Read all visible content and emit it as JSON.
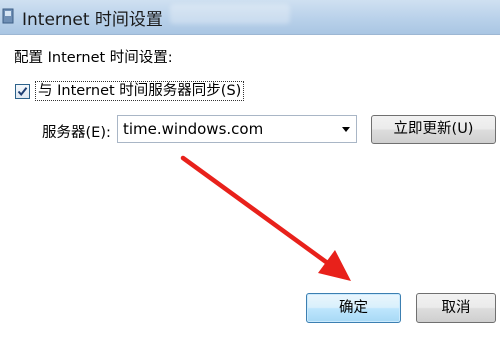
{
  "window": {
    "title": "Internet 时间设置"
  },
  "dialog": {
    "config_label": "配置 Internet 时间设置:",
    "sync_checkbox": {
      "label": "与 Internet 时间服务器同步(S)",
      "checked": true
    },
    "server": {
      "label": "服务器(E):",
      "value": "time.windows.com"
    },
    "update_button": "立即更新(U)",
    "ok_button": "确定",
    "cancel_button": "取消"
  },
  "annotation": {
    "color": "#e8211b"
  },
  "colors": {
    "titlebar": "#b9d1ea",
    "ok_border": "#3c7fb1",
    "checkbox_border": "#2c628b"
  },
  "icons": [
    "window-app-icon",
    "checkmark-icon",
    "dropdown-arrow-icon",
    "red-pointer-arrow-icon"
  ]
}
